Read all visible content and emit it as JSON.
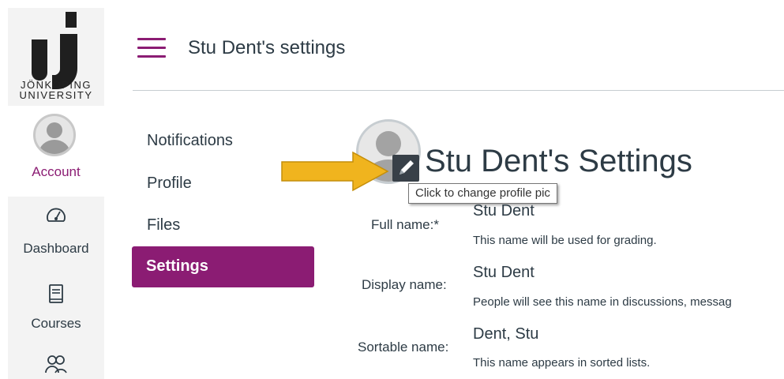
{
  "global_nav": {
    "logo": {
      "line1": "JÖNKÖPING",
      "line2": "UNIVERSITY"
    },
    "items": [
      {
        "label": "Account",
        "icon": "user-avatar-icon"
      },
      {
        "label": "Dashboard",
        "icon": "dashboard-gauge-icon"
      },
      {
        "label": "Courses",
        "icon": "book-icon"
      },
      {
        "label": "",
        "icon": "groups-icon"
      }
    ],
    "accent_color": "#8b1c73"
  },
  "header": {
    "title": "Stu Dent's settings"
  },
  "left_menu": {
    "items": [
      "Notifications",
      "Profile",
      "Files",
      "Settings"
    ],
    "active": "Settings"
  },
  "profile": {
    "heading": "Stu Dent's Settings",
    "edit_icon": "pencil-icon",
    "tooltip": "Click to change profile pic"
  },
  "fields": [
    {
      "label": "Full name:*",
      "value": "Stu Dent",
      "help": "This name will be used for grading."
    },
    {
      "label": "Display name:",
      "value": "Stu Dent",
      "help": "People will see this name in discussions, messag"
    },
    {
      "label": "Sortable name:",
      "value": "Dent, Stu",
      "help": "This name appears in sorted lists."
    }
  ]
}
